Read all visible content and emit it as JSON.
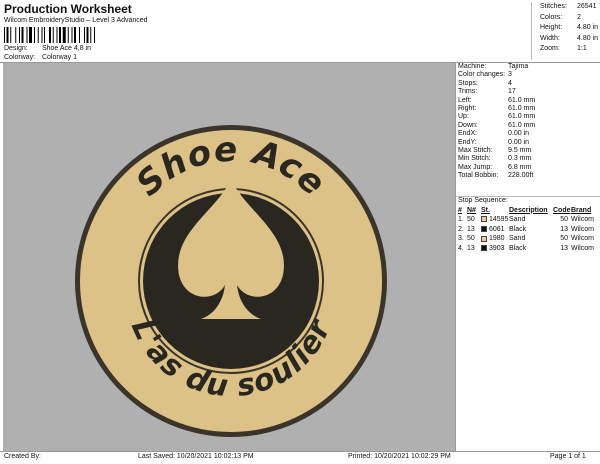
{
  "header": {
    "title": "Production Worksheet",
    "subtitle": "Wilcom EmbroideryStudio – Level 3 Advanced",
    "design_label": "Design:",
    "design_value": "Shoe Ace 4,8 in",
    "colorway_label": "Colorway:",
    "colorway_value": "Colorway 1"
  },
  "header_stats": [
    {
      "label": "Stitches:",
      "value": "26541"
    },
    {
      "label": "Colors:",
      "value": "2"
    },
    {
      "label": "Height:",
      "value": "4.80 in"
    },
    {
      "label": "Width:",
      "value": "4.80 in"
    },
    {
      "label": "Zoom:",
      "value": "1:1"
    }
  ],
  "design": {
    "top_text": "Shoe Ace",
    "bottom_text": "L'as du soulier",
    "colors": {
      "background": "#b0b0b0",
      "fill": "#dcc286",
      "dark": "#2a2620"
    }
  },
  "stats": [
    {
      "label": "Machine:",
      "value": "Tajima"
    },
    {
      "label": "Color changes:",
      "value": "3"
    },
    {
      "label": "Stops:",
      "value": "4"
    },
    {
      "label": "Trims:",
      "value": "17"
    },
    {
      "label": "Left:",
      "value": "61.0 mm"
    },
    {
      "label": "Right:",
      "value": "61.0 mm"
    },
    {
      "label": "Up:",
      "value": "61.0 mm"
    },
    {
      "label": "Down:",
      "value": "61.0 mm"
    },
    {
      "label": "EndX:",
      "value": "0.00 in"
    },
    {
      "label": "EndY:",
      "value": "0.00 in"
    },
    {
      "label": "Max Stitch:",
      "value": "9.5 mm"
    },
    {
      "label": "Min Stitch:",
      "value": "0.3 mm"
    },
    {
      "label": "Max Jump:",
      "value": "6.8 mm"
    },
    {
      "label": "Total Bobbin:",
      "value": "228.00ft"
    }
  ],
  "sequence": {
    "title": "Stop Sequence:",
    "columns": [
      "#",
      "N#",
      "St.",
      "Description",
      "Code",
      "Brand"
    ],
    "rows": [
      {
        "idx": "1.",
        "n": "50",
        "color": "#f2c89a",
        "st": "14595",
        "desc": "Sand",
        "code": "50",
        "brand": "Wilcom"
      },
      {
        "idx": "2.",
        "n": "13",
        "color": "#111111",
        "st": "6061",
        "desc": "Black",
        "code": "13",
        "brand": "Wilcom"
      },
      {
        "idx": "3.",
        "n": "50",
        "color": "#f2c89a",
        "st": "1980",
        "desc": "Sand",
        "code": "50",
        "brand": "Wilcom"
      },
      {
        "idx": "4.",
        "n": "13",
        "color": "#111111",
        "st": "3903",
        "desc": "Black",
        "code": "13",
        "brand": "Wilcom"
      }
    ]
  },
  "footer": {
    "created_by": "Created By:",
    "last_saved": "Last Saved: 10/20/2021 10:02:13 PM",
    "printed": "Printed: 10/20/2021 10:02:29 PM",
    "page": "Page 1 of 1"
  }
}
